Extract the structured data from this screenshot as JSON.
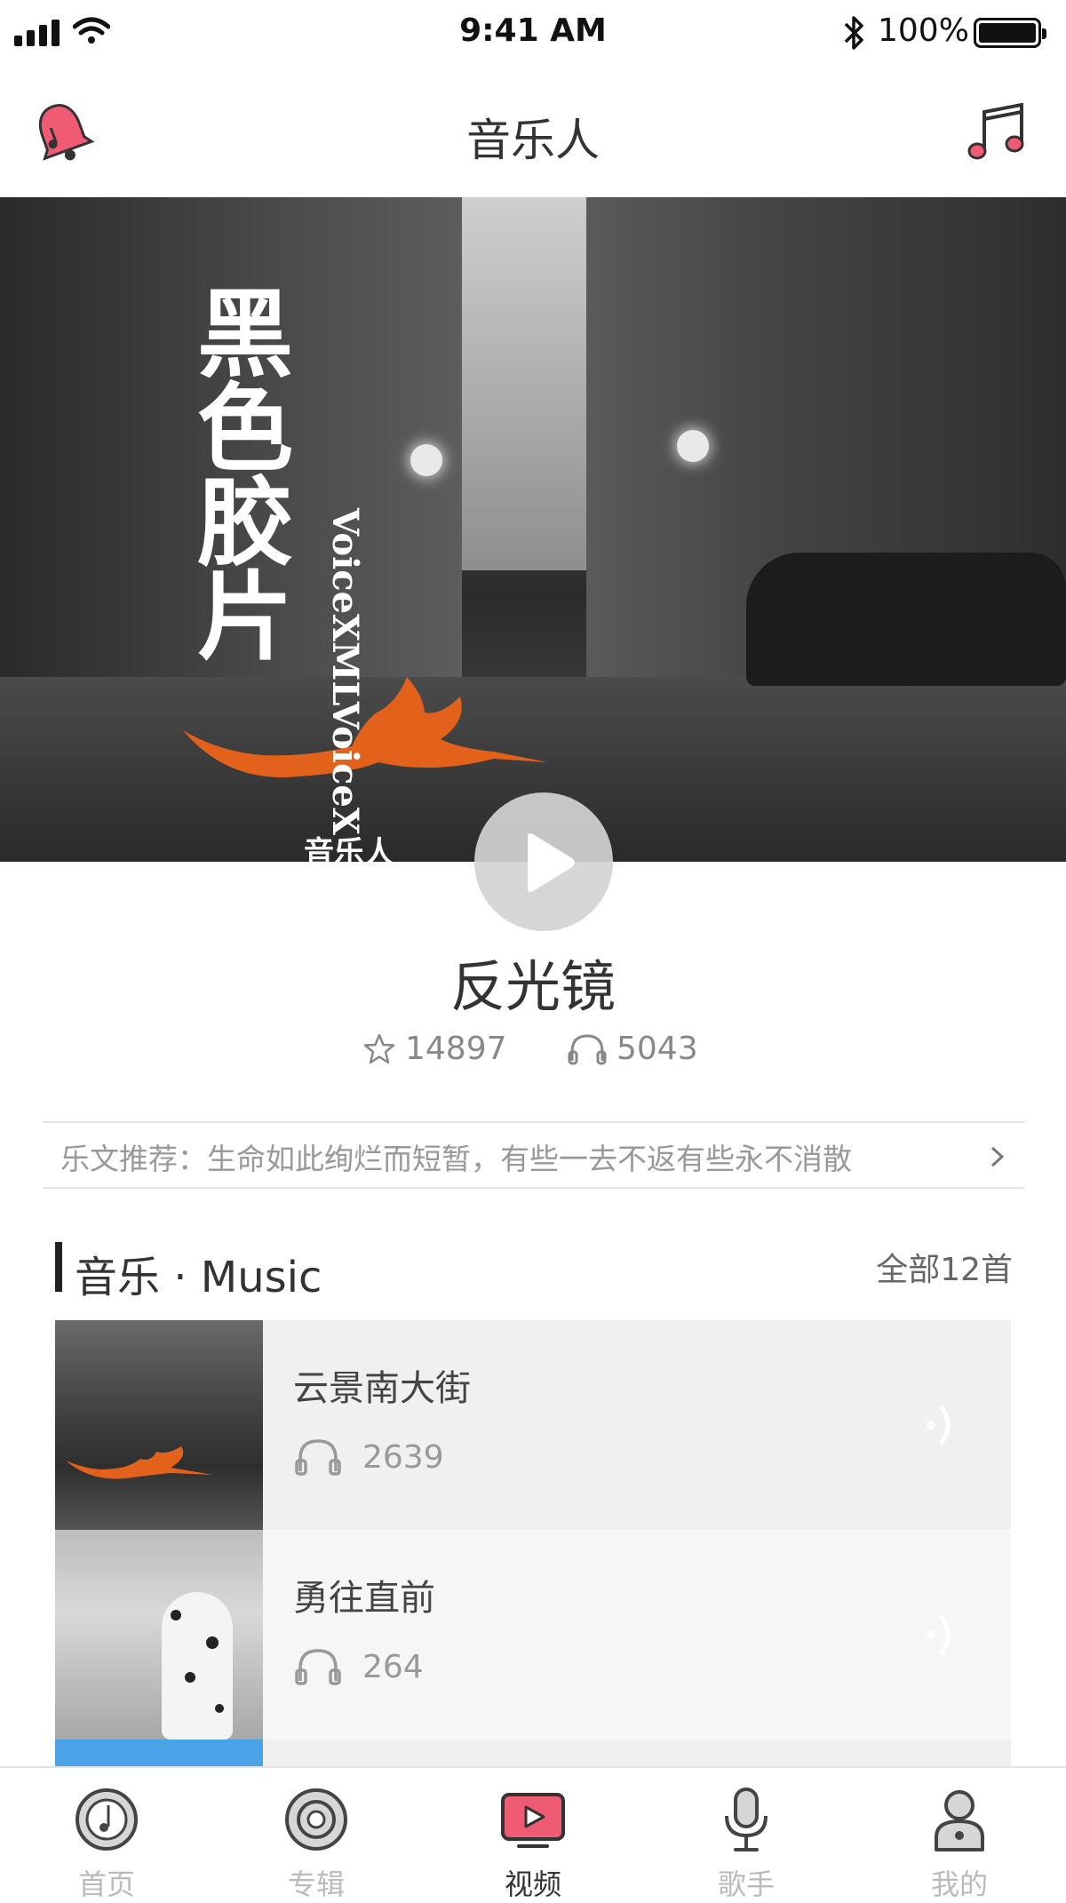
{
  "status_bar": {
    "time": "9:41 AM",
    "battery": "100%"
  },
  "nav": {
    "title": "音乐人"
  },
  "hero": {
    "title": "黑色胶片",
    "vertical_text": "VoiceXMLVoiceX",
    "subtitle": "音乐人"
  },
  "song": {
    "title": "反光镜",
    "favorites": "14897",
    "listens": "5043"
  },
  "recommend": {
    "text": "乐文推荐：生命如此绚烂而短暂，有些一去不返有些永不消散"
  },
  "music_section": {
    "title": "音乐 · Music",
    "all_label": "全部12首",
    "songs": [
      {
        "name": "云景南大街",
        "plays": "2639"
      },
      {
        "name": "勇往直前",
        "plays": "264"
      }
    ]
  },
  "tabs": [
    {
      "label": "首页",
      "icon": "music-disc-icon"
    },
    {
      "label": "专辑",
      "icon": "vinyl-icon"
    },
    {
      "label": "视频",
      "icon": "video-play-icon",
      "active": true
    },
    {
      "label": "歌手",
      "icon": "microphone-icon"
    },
    {
      "label": "我的",
      "icon": "user-icon"
    }
  ],
  "colors": {
    "accent": "#e8506a",
    "text": "#333333",
    "muted": "#999999"
  }
}
